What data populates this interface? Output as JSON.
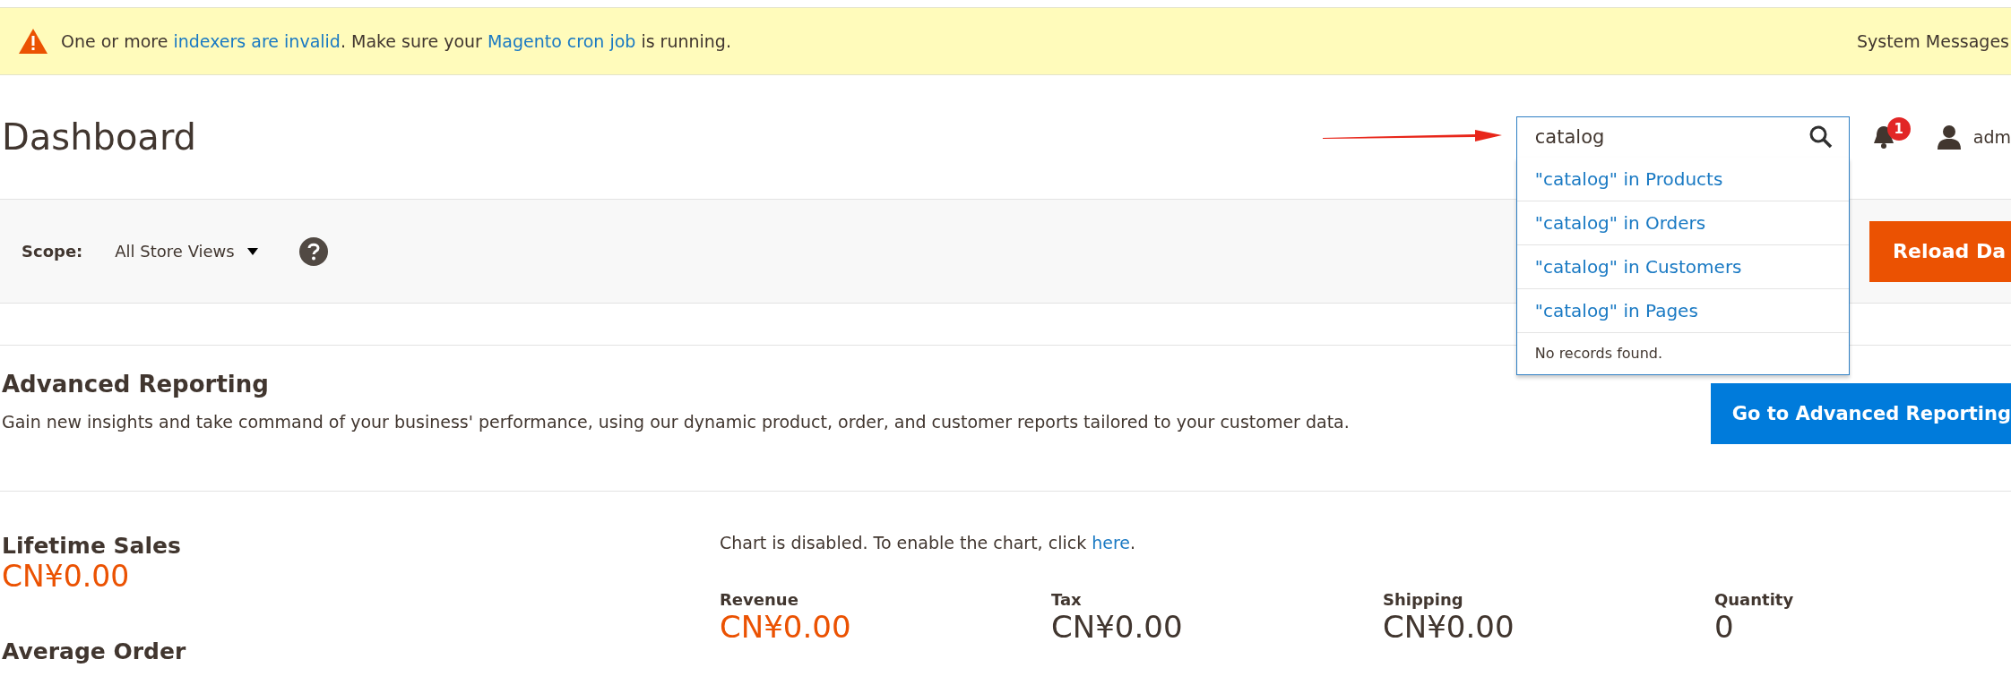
{
  "system_message": {
    "segments": [
      {
        "text": "One or more ",
        "link": false
      },
      {
        "text": "indexers are invalid",
        "link": true
      },
      {
        "text": ". Make sure your ",
        "link": false
      },
      {
        "text": "Magento cron job",
        "link": true
      },
      {
        "text": " is running.",
        "link": false
      }
    ],
    "link_label": "System Messages"
  },
  "header": {
    "title": "Dashboard",
    "search": {
      "value": "catalog",
      "suggestions": [
        "\"catalog\" in Products",
        "\"catalog\" in Orders",
        "\"catalog\" in Customers",
        "\"catalog\" in Pages"
      ],
      "empty_note": "No records found."
    },
    "notifications_count": "1",
    "user": "adm"
  },
  "scope": {
    "label": "Scope:",
    "value": "All Store Views",
    "button": "Reload Da"
  },
  "advanced_reporting": {
    "title": "Advanced Reporting",
    "description": "Gain new insights and take command of your business' performance, using our dynamic product, order, and customer reports tailored to your customer data.",
    "button": "Go to Advanced Reporting"
  },
  "summary": [
    {
      "label": "Lifetime Sales",
      "value": "CN¥0.00",
      "color": "#eb5202"
    },
    {
      "label": "Average Order"
    }
  ],
  "chart_note": {
    "text": "Chart is disabled. To enable the chart, click ",
    "link": "here",
    "after": "."
  },
  "totals": [
    {
      "label": "Revenue",
      "value": "CN¥0.00",
      "color": "#eb5202"
    },
    {
      "label": "Tax",
      "value": "CN¥0.00",
      "color": "#41362f"
    },
    {
      "label": "Shipping",
      "value": "CN¥0.00",
      "color": "#41362f"
    },
    {
      "label": "Quantity",
      "value": "0",
      "color": "#41362f"
    }
  ]
}
